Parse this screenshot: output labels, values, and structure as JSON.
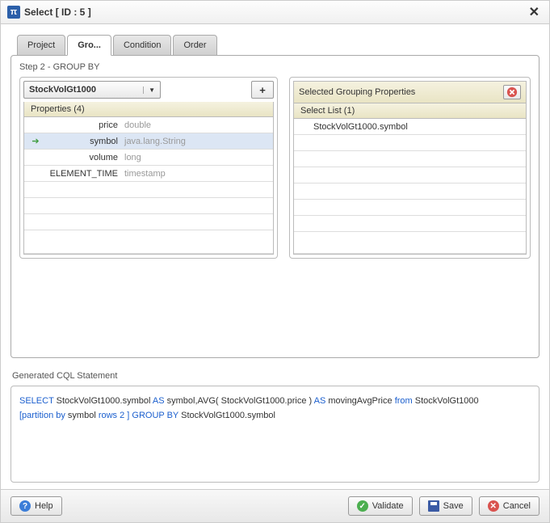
{
  "title": "Select [ ID : 5 ]",
  "tabs": [
    {
      "label": "Project",
      "active": false
    },
    {
      "label": "Gro...",
      "active": true
    },
    {
      "label": "Condition",
      "active": false
    },
    {
      "label": "Order",
      "active": false
    }
  ],
  "step_label": "Step 2 - GROUP BY",
  "dropdown_value": "StockVolGt1000",
  "add_button": "+",
  "properties_header": "Properties (4)",
  "properties": [
    {
      "name": "price",
      "type": "double",
      "selected": false,
      "marked": false
    },
    {
      "name": "symbol",
      "type": "java.lang.String",
      "selected": true,
      "marked": true
    },
    {
      "name": "volume",
      "type": "long",
      "selected": false,
      "marked": false
    },
    {
      "name": "ELEMENT_TIME",
      "type": "timestamp",
      "selected": false,
      "marked": false
    }
  ],
  "selected_panel_header": "Selected Grouping Properties",
  "select_list_header": "Select List (1)",
  "selected_items": [
    {
      "label": "StockVolGt1000.symbol"
    }
  ],
  "gen_label": "Generated CQL Statement",
  "cql": {
    "p1": "SELECT ",
    "p2": "StockVolGt1000.symbol ",
    "p3": "AS ",
    "p4": "symbol,AVG( StockVolGt1000.price ) ",
    "p5": "AS ",
    "p6": "movingAvgPrice ",
    "p7": "from  ",
    "p8": "StockVolGt1000 ",
    "p9": "[partition by ",
    "p10": " symbol  ",
    "p11": "rows 2 ] GROUP BY ",
    "p12": "StockVolGt1000.symbol"
  },
  "buttons": {
    "help": "Help",
    "validate": "Validate",
    "save": "Save",
    "cancel": "Cancel"
  }
}
